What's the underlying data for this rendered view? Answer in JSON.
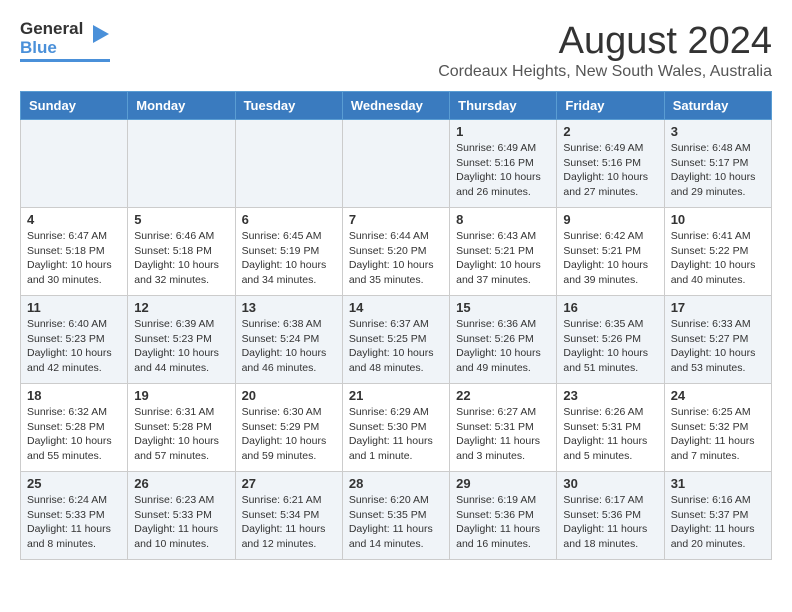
{
  "logo": {
    "line1": "General",
    "line2": "Blue"
  },
  "title": "August 2024",
  "subtitle": "Cordeaux Heights, New South Wales, Australia",
  "days_of_week": [
    "Sunday",
    "Monday",
    "Tuesday",
    "Wednesday",
    "Thursday",
    "Friday",
    "Saturday"
  ],
  "weeks": [
    [
      {
        "day": "",
        "text": ""
      },
      {
        "day": "",
        "text": ""
      },
      {
        "day": "",
        "text": ""
      },
      {
        "day": "",
        "text": ""
      },
      {
        "day": "1",
        "text": "Sunrise: 6:49 AM\nSunset: 5:16 PM\nDaylight: 10 hours\nand 26 minutes."
      },
      {
        "day": "2",
        "text": "Sunrise: 6:49 AM\nSunset: 5:16 PM\nDaylight: 10 hours\nand 27 minutes."
      },
      {
        "day": "3",
        "text": "Sunrise: 6:48 AM\nSunset: 5:17 PM\nDaylight: 10 hours\nand 29 minutes."
      }
    ],
    [
      {
        "day": "4",
        "text": "Sunrise: 6:47 AM\nSunset: 5:18 PM\nDaylight: 10 hours\nand 30 minutes."
      },
      {
        "day": "5",
        "text": "Sunrise: 6:46 AM\nSunset: 5:18 PM\nDaylight: 10 hours\nand 32 minutes."
      },
      {
        "day": "6",
        "text": "Sunrise: 6:45 AM\nSunset: 5:19 PM\nDaylight: 10 hours\nand 34 minutes."
      },
      {
        "day": "7",
        "text": "Sunrise: 6:44 AM\nSunset: 5:20 PM\nDaylight: 10 hours\nand 35 minutes."
      },
      {
        "day": "8",
        "text": "Sunrise: 6:43 AM\nSunset: 5:21 PM\nDaylight: 10 hours\nand 37 minutes."
      },
      {
        "day": "9",
        "text": "Sunrise: 6:42 AM\nSunset: 5:21 PM\nDaylight: 10 hours\nand 39 minutes."
      },
      {
        "day": "10",
        "text": "Sunrise: 6:41 AM\nSunset: 5:22 PM\nDaylight: 10 hours\nand 40 minutes."
      }
    ],
    [
      {
        "day": "11",
        "text": "Sunrise: 6:40 AM\nSunset: 5:23 PM\nDaylight: 10 hours\nand 42 minutes."
      },
      {
        "day": "12",
        "text": "Sunrise: 6:39 AM\nSunset: 5:23 PM\nDaylight: 10 hours\nand 44 minutes."
      },
      {
        "day": "13",
        "text": "Sunrise: 6:38 AM\nSunset: 5:24 PM\nDaylight: 10 hours\nand 46 minutes."
      },
      {
        "day": "14",
        "text": "Sunrise: 6:37 AM\nSunset: 5:25 PM\nDaylight: 10 hours\nand 48 minutes."
      },
      {
        "day": "15",
        "text": "Sunrise: 6:36 AM\nSunset: 5:26 PM\nDaylight: 10 hours\nand 49 minutes."
      },
      {
        "day": "16",
        "text": "Sunrise: 6:35 AM\nSunset: 5:26 PM\nDaylight: 10 hours\nand 51 minutes."
      },
      {
        "day": "17",
        "text": "Sunrise: 6:33 AM\nSunset: 5:27 PM\nDaylight: 10 hours\nand 53 minutes."
      }
    ],
    [
      {
        "day": "18",
        "text": "Sunrise: 6:32 AM\nSunset: 5:28 PM\nDaylight: 10 hours\nand 55 minutes."
      },
      {
        "day": "19",
        "text": "Sunrise: 6:31 AM\nSunset: 5:28 PM\nDaylight: 10 hours\nand 57 minutes."
      },
      {
        "day": "20",
        "text": "Sunrise: 6:30 AM\nSunset: 5:29 PM\nDaylight: 10 hours\nand 59 minutes."
      },
      {
        "day": "21",
        "text": "Sunrise: 6:29 AM\nSunset: 5:30 PM\nDaylight: 11 hours\nand 1 minute."
      },
      {
        "day": "22",
        "text": "Sunrise: 6:27 AM\nSunset: 5:31 PM\nDaylight: 11 hours\nand 3 minutes."
      },
      {
        "day": "23",
        "text": "Sunrise: 6:26 AM\nSunset: 5:31 PM\nDaylight: 11 hours\nand 5 minutes."
      },
      {
        "day": "24",
        "text": "Sunrise: 6:25 AM\nSunset: 5:32 PM\nDaylight: 11 hours\nand 7 minutes."
      }
    ],
    [
      {
        "day": "25",
        "text": "Sunrise: 6:24 AM\nSunset: 5:33 PM\nDaylight: 11 hours\nand 8 minutes."
      },
      {
        "day": "26",
        "text": "Sunrise: 6:23 AM\nSunset: 5:33 PM\nDaylight: 11 hours\nand 10 minutes."
      },
      {
        "day": "27",
        "text": "Sunrise: 6:21 AM\nSunset: 5:34 PM\nDaylight: 11 hours\nand 12 minutes."
      },
      {
        "day": "28",
        "text": "Sunrise: 6:20 AM\nSunset: 5:35 PM\nDaylight: 11 hours\nand 14 minutes."
      },
      {
        "day": "29",
        "text": "Sunrise: 6:19 AM\nSunset: 5:36 PM\nDaylight: 11 hours\nand 16 minutes."
      },
      {
        "day": "30",
        "text": "Sunrise: 6:17 AM\nSunset: 5:36 PM\nDaylight: 11 hours\nand 18 minutes."
      },
      {
        "day": "31",
        "text": "Sunrise: 6:16 AM\nSunset: 5:37 PM\nDaylight: 11 hours\nand 20 minutes."
      }
    ]
  ]
}
